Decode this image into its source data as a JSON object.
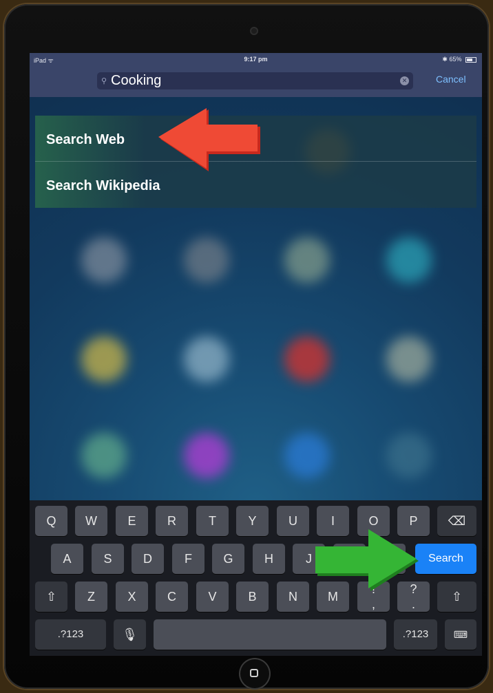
{
  "status_bar": {
    "carrier": "iPad ᯤ",
    "time": "9:17 pm",
    "battery": "✱ 65%"
  },
  "search": {
    "value": "Cooking",
    "cancel_label": "Cancel"
  },
  "results": [
    {
      "label": "Search Web"
    },
    {
      "label": "Search Wikipedia"
    }
  ],
  "keyboard": {
    "row1": [
      "Q",
      "W",
      "E",
      "R",
      "T",
      "Y",
      "U",
      "I",
      "O",
      "P"
    ],
    "row2": [
      "A",
      "S",
      "D",
      "F",
      "G",
      "H",
      "J"
    ],
    "row3": [
      "Z",
      "X",
      "C",
      "V",
      "B",
      "N",
      "M",
      "!",
      "?"
    ],
    "row3_sub": [
      ",",
      "."
    ],
    "search_label": "Search",
    "num_label_left": ".?123",
    "num_label_right": ".?123",
    "backspace_icon": "backspace-icon",
    "shift_icon": "shift-icon",
    "mic_icon": "microphone-icon",
    "hide_keyboard_icon": "keyboard-dismiss-icon"
  },
  "colors": {
    "accent": "#1a82f7",
    "arrow_red": "#e53b2c",
    "arrow_green": "#2eab2e"
  }
}
